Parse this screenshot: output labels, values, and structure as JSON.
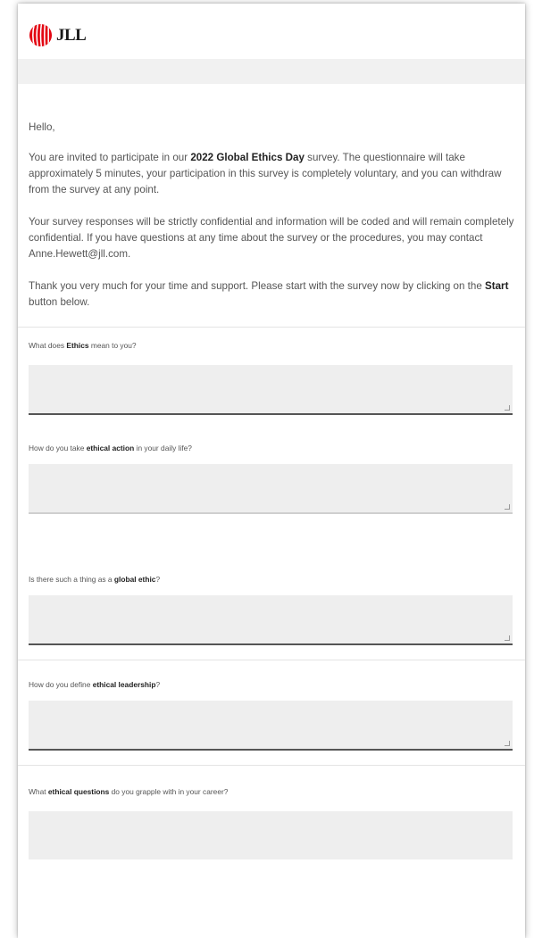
{
  "brand": {
    "name": "JLL",
    "accent": "#e30613"
  },
  "intro": {
    "greeting": "Hello,",
    "p1_before": "You are invited to participate in our ",
    "p1_bold": "2022 Global Ethics Day",
    "p1_after": " survey.  The questionnaire will take approximately 5 minutes, your participation in this survey is completely voluntary, and you can withdraw from the survey at any point.",
    "p2": "Your survey responses will be strictly confidential and  information will be coded and will remain completely confidential. If you have questions at any time about the survey or the procedures, you may contact Anne.Hewett@jll.com.",
    "p3_before": "Thank you very much for your time and support. Please start with the survey now by clicking on the ",
    "p3_bold": "Start",
    "p3_after": " button below."
  },
  "questions": [
    {
      "before": "What does ",
      "bold": "Ethics",
      "after": " mean to you?",
      "value": ""
    },
    {
      "before": "How do you take ",
      "bold": "ethical action",
      "after": " in your daily life?",
      "value": ""
    },
    {
      "before": "Is there such a thing as a ",
      "bold": "global ethic",
      "after": "?",
      "value": ""
    },
    {
      "before": "How do you define ",
      "bold": "ethical leadership",
      "after": "?",
      "value": ""
    },
    {
      "before": "What ",
      "bold": "ethical questions",
      "after": " do you grapple with in your career?",
      "value": ""
    }
  ]
}
